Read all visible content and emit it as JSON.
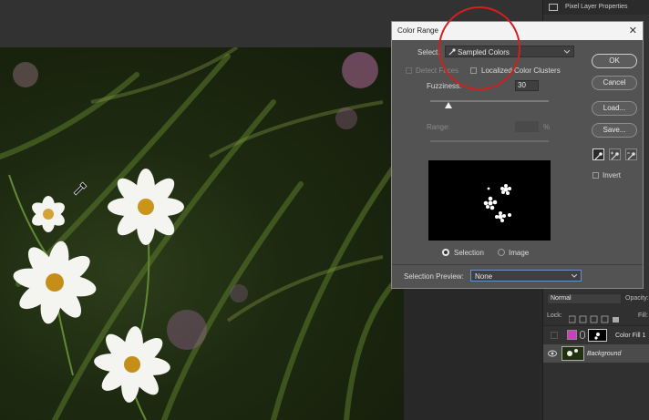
{
  "panel": {
    "title": "Pixel Layer Properties",
    "blend_mode": "Normal",
    "opacity_label": "Opacity:",
    "lock_label": "Lock:",
    "fill_label": "Fill:"
  },
  "layers": [
    {
      "name": "Color Fill 1"
    },
    {
      "name": "Background"
    }
  ],
  "dialog": {
    "title": "Color Range",
    "close_symbol": "✕",
    "select_label": "Select:",
    "select_value": "Sampled Colors",
    "detect_faces_label": "Detect Faces",
    "localized_label": "Localized Color Clusters",
    "fuzziness_label": "Fuzziness:",
    "fuzziness_value": "30",
    "fuzziness_fraction": 0.15,
    "range_label": "Range:",
    "range_unit": "%",
    "mode_selection": "Selection",
    "mode_image": "Image",
    "selection_preview_label": "Selection Preview:",
    "selection_preview_value": "None",
    "buttons": {
      "ok": "OK",
      "cancel": "Cancel",
      "load": "Load...",
      "save": "Save..."
    },
    "invert_label": "Invert",
    "icons": [
      "eyedropper-icon",
      "eyedropper-plus-icon",
      "eyedropper-minus-icon",
      "chevron-down-icon",
      "eye-icon",
      "close-icon"
    ]
  },
  "colors": {
    "annotation_circle": "#d21f1f",
    "fill_swatch": "#c93fbd",
    "dialog_bg": "#535353"
  }
}
